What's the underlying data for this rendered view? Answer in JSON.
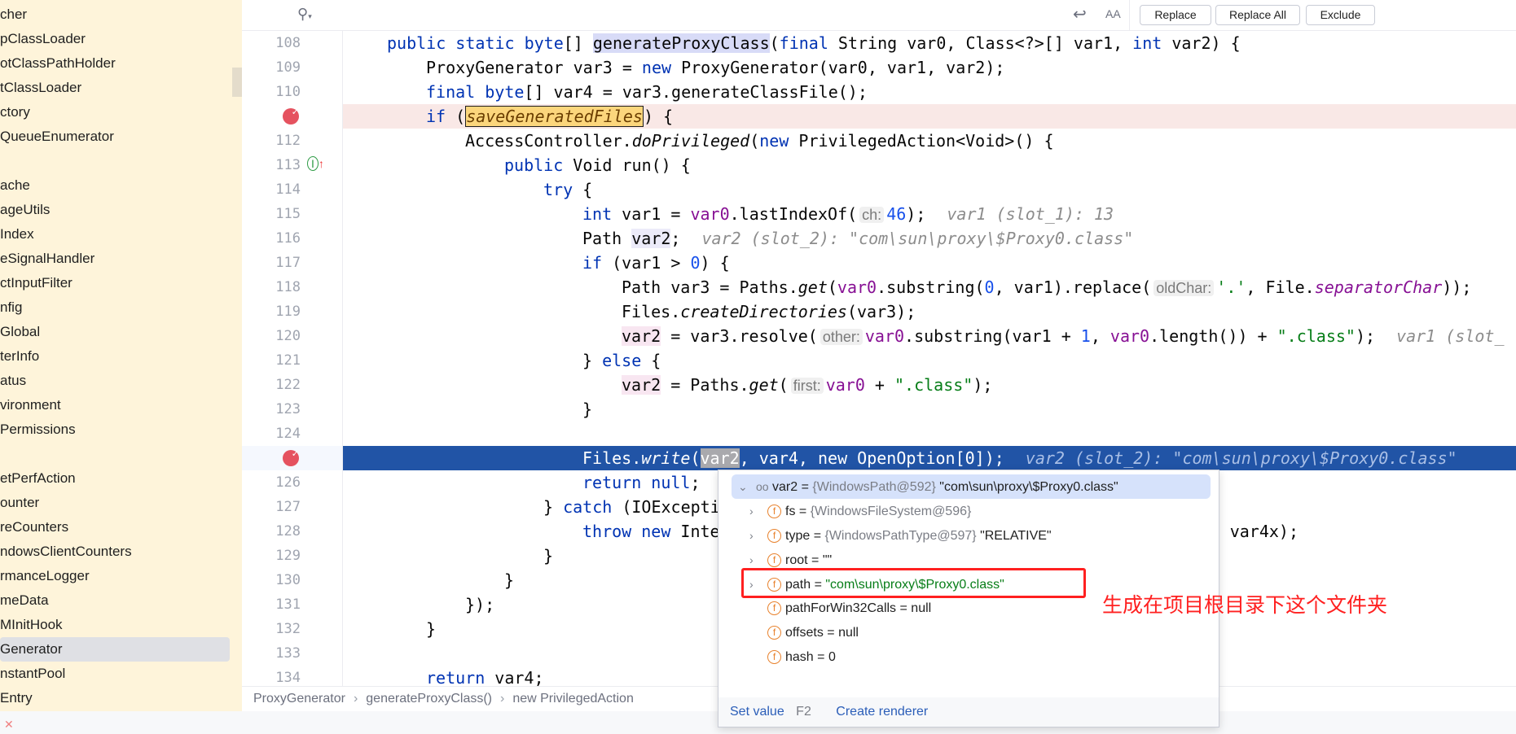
{
  "sidebar": {
    "items": [
      "cher",
      "pClassLoader",
      "otClassPathHolder",
      "tClassLoader",
      "ctory",
      "QueueEnumerator",
      "",
      "ache",
      "ageUtils",
      "Index",
      "eSignalHandler",
      "ctInputFilter",
      "nfig",
      "Global",
      "terInfo",
      "atus",
      "vironment",
      "Permissions",
      "",
      "etPerfAction",
      "ounter",
      "reCounters",
      "ndowsClientCounters",
      "rmanceLogger",
      "meData",
      "MInitHook",
      "Generator",
      "nstantPool",
      "Entry"
    ],
    "selected_index": 26
  },
  "toolbar": {
    "search_icon": "search-icon",
    "wrap_icon": "wrap-arrow-icon",
    "case_icon": "match-case-icon",
    "case_glyph": "AA",
    "replace": "Replace",
    "replace_all": "Replace All",
    "exclude": "Exclude"
  },
  "editor": {
    "breakpoint_lines": [
      111,
      125
    ],
    "current_line": 125,
    "lines": [
      {
        "n": "108",
        "i": 1,
        "t": [
          [
            "kw",
            "public static byte"
          ],
          [
            "",
            "[] "
          ],
          [
            "hl",
            "generateProxyClass"
          ],
          [
            "",
            "("
          ],
          [
            "kw",
            "final"
          ],
          [
            "",
            " String var0, Class<?>[] var1, "
          ],
          [
            "kw",
            "int"
          ],
          [
            "",
            " var2) {"
          ]
        ]
      },
      {
        "n": "109",
        "i": 2,
        "t": [
          [
            "",
            "ProxyGenerator var3 = "
          ],
          [
            "kw",
            "new"
          ],
          [
            "",
            " ProxyGenerator(var0, var1, var2);"
          ]
        ]
      },
      {
        "n": "110",
        "i": 2,
        "t": [
          [
            "kw",
            "final byte"
          ],
          [
            "",
            "[] var4 = var3.generateClassFile();"
          ]
        ]
      },
      {
        "n": "",
        "i": 2,
        "t": [
          [
            "kw",
            "if"
          ],
          [
            "",
            " ("
          ],
          [
            "yel",
            "saveGeneratedFiles"
          ],
          [
            "",
            ") {"
          ]
        ]
      },
      {
        "n": "112",
        "i": 3,
        "t": [
          [
            "",
            "AccessController."
          ],
          [
            "it",
            "doPrivileged"
          ],
          [
            "",
            "("
          ],
          [
            "kw",
            "new"
          ],
          [
            "",
            " PrivilegedAction<Void>() {"
          ]
        ]
      },
      {
        "n": "113",
        "i": 4,
        "t": [
          [
            "kw",
            "public"
          ],
          [
            "",
            " Void run() {"
          ]
        ]
      },
      {
        "n": "114",
        "i": 5,
        "t": [
          [
            "kw",
            "try"
          ],
          [
            "",
            " {"
          ]
        ]
      },
      {
        "n": "115",
        "i": 6,
        "t": [
          [
            "kw",
            "int"
          ],
          [
            "",
            " var1 = "
          ],
          [
            "var",
            "var0"
          ],
          [
            "",
            ".lastIndexOf("
          ],
          [
            "hint",
            "ch:"
          ],
          [
            "num",
            "46"
          ],
          [
            "",
            ");"
          ],
          [
            "cmt",
            "var1 (slot_1): 13"
          ]
        ]
      },
      {
        "n": "116",
        "i": 6,
        "t": [
          [
            "",
            "Path "
          ],
          [
            "hlv",
            "var2"
          ],
          [
            "",
            ";"
          ],
          [
            "cmt",
            "var2 (slot_2): \"com\\sun\\proxy\\$Proxy0.class\""
          ]
        ]
      },
      {
        "n": "117",
        "i": 6,
        "t": [
          [
            "kw",
            "if"
          ],
          [
            "",
            " (var1 > "
          ],
          [
            "num",
            "0"
          ],
          [
            "",
            ") {"
          ]
        ]
      },
      {
        "n": "118",
        "i": 7,
        "t": [
          [
            "",
            "Path var3 = Paths."
          ],
          [
            "it",
            "get"
          ],
          [
            "",
            "("
          ],
          [
            "var",
            "var0"
          ],
          [
            "",
            ".substring("
          ],
          [
            "num",
            "0"
          ],
          [
            "",
            ", var1).replace("
          ],
          [
            "hint",
            "oldChar:"
          ],
          [
            "str",
            "'.'"
          ],
          [
            "",
            ", File."
          ],
          [
            "itvar",
            "separatorChar"
          ],
          [
            "",
            "));"
          ]
        ]
      },
      {
        "n": "119",
        "i": 7,
        "t": [
          [
            "",
            "Files."
          ],
          [
            "it",
            "createDirectories"
          ],
          [
            "",
            "(var3);"
          ]
        ]
      },
      {
        "n": "120",
        "i": 7,
        "t": [
          [
            "wv",
            "var2"
          ],
          [
            "",
            " = var3.resolve("
          ],
          [
            "hint",
            "other:"
          ],
          [
            "var",
            "var0"
          ],
          [
            "",
            ".substring(var1 + "
          ],
          [
            "num",
            "1"
          ],
          [
            "",
            ", "
          ],
          [
            "var",
            "var0"
          ],
          [
            "",
            ".length()) + "
          ],
          [
            "str",
            "\".class\""
          ],
          [
            "",
            ");"
          ],
          [
            "cmt",
            "var1 (slot_"
          ]
        ]
      },
      {
        "n": "121",
        "i": 6,
        "t": [
          [
            "",
            "} "
          ],
          [
            "kw",
            "else"
          ],
          [
            "",
            " {"
          ]
        ]
      },
      {
        "n": "122",
        "i": 7,
        "t": [
          [
            "wv",
            "var2"
          ],
          [
            "",
            " = Paths."
          ],
          [
            "it",
            "get"
          ],
          [
            "",
            "("
          ],
          [
            "hint",
            "first:"
          ],
          [
            "var",
            "var0"
          ],
          [
            "",
            " + "
          ],
          [
            "str",
            "\".class\""
          ],
          [
            "",
            ");"
          ]
        ]
      },
      {
        "n": "123",
        "i": 6,
        "t": [
          [
            "",
            "}"
          ]
        ]
      },
      {
        "n": "124",
        "i": 0,
        "t": []
      },
      {
        "n": "",
        "i": 6,
        "t": [
          [
            "",
            "Files."
          ],
          [
            "it",
            "write"
          ],
          [
            "",
            "("
          ],
          [
            "selv",
            "var2"
          ],
          [
            "",
            ", var4, new OpenOption[0]);"
          ],
          [
            "cmt",
            "var2 (slot_2): \"com\\sun\\proxy\\$Proxy0.class\""
          ]
        ]
      },
      {
        "n": "126",
        "i": 6,
        "t": [
          [
            "kw",
            "return null"
          ],
          [
            "",
            ";"
          ]
        ]
      },
      {
        "n": "127",
        "i": 5,
        "t": [
          [
            "",
            "} "
          ],
          [
            "kw",
            "catch"
          ],
          [
            "",
            " (IOException var4x) {"
          ]
        ]
      },
      {
        "n": "128",
        "i": 6,
        "t": [
          [
            "kw",
            "throw new"
          ],
          [
            "",
            " InternalError(\"I/O exception saving generated file: \" + var4x);"
          ]
        ]
      },
      {
        "n": "129",
        "i": 5,
        "t": [
          [
            "",
            "}"
          ]
        ]
      },
      {
        "n": "130",
        "i": 4,
        "t": [
          [
            "",
            "}"
          ]
        ]
      },
      {
        "n": "131",
        "i": 3,
        "t": [
          [
            "",
            "});"
          ]
        ]
      },
      {
        "n": "132",
        "i": 2,
        "t": [
          [
            "",
            "}"
          ]
        ]
      },
      {
        "n": "133",
        "i": 0,
        "t": []
      },
      {
        "n": "134",
        "i": 2,
        "t": [
          [
            "kw",
            "return"
          ],
          [
            "",
            " var4;"
          ]
        ]
      }
    ]
  },
  "popup": {
    "header": {
      "name": "var2",
      "eq": " = ",
      "type": "{WindowsPath@592}",
      "value": "\"com\\sun\\proxy\\$Proxy0.class\""
    },
    "fields": [
      {
        "name": "fs",
        "eq": " = ",
        "type": "{WindowsFileSystem@596}",
        "value": "",
        "expandable": true
      },
      {
        "name": "type",
        "eq": " = ",
        "type": "{WindowsPathType@597}",
        "value": " \"RELATIVE\"",
        "expandable": true
      },
      {
        "name": "root",
        "eq": " = ",
        "type": "",
        "value": "\"\"",
        "expandable": true
      },
      {
        "name": "path",
        "eq": " = ",
        "type": "",
        "value": "\"com\\sun\\proxy\\$Proxy0.class\"",
        "expandable": true,
        "green": true
      },
      {
        "name": "pathForWin32Calls",
        "eq": " = ",
        "type": "",
        "value": "null",
        "expandable": false
      },
      {
        "name": "offsets",
        "eq": " = ",
        "type": "",
        "value": "null",
        "expandable": false
      },
      {
        "name": "hash",
        "eq": " = ",
        "type": "",
        "value": "0",
        "expandable": false
      }
    ],
    "set_value": "Set value",
    "set_value_key": "F2",
    "create_renderer": "Create renderer"
  },
  "annotation": {
    "note": "生成在项目根目录下这个文件夹",
    "color": "#ff2020"
  },
  "breadcrumbs": [
    "ProxyGenerator",
    "generateProxyClass()",
    "new PrivilegedAction"
  ]
}
